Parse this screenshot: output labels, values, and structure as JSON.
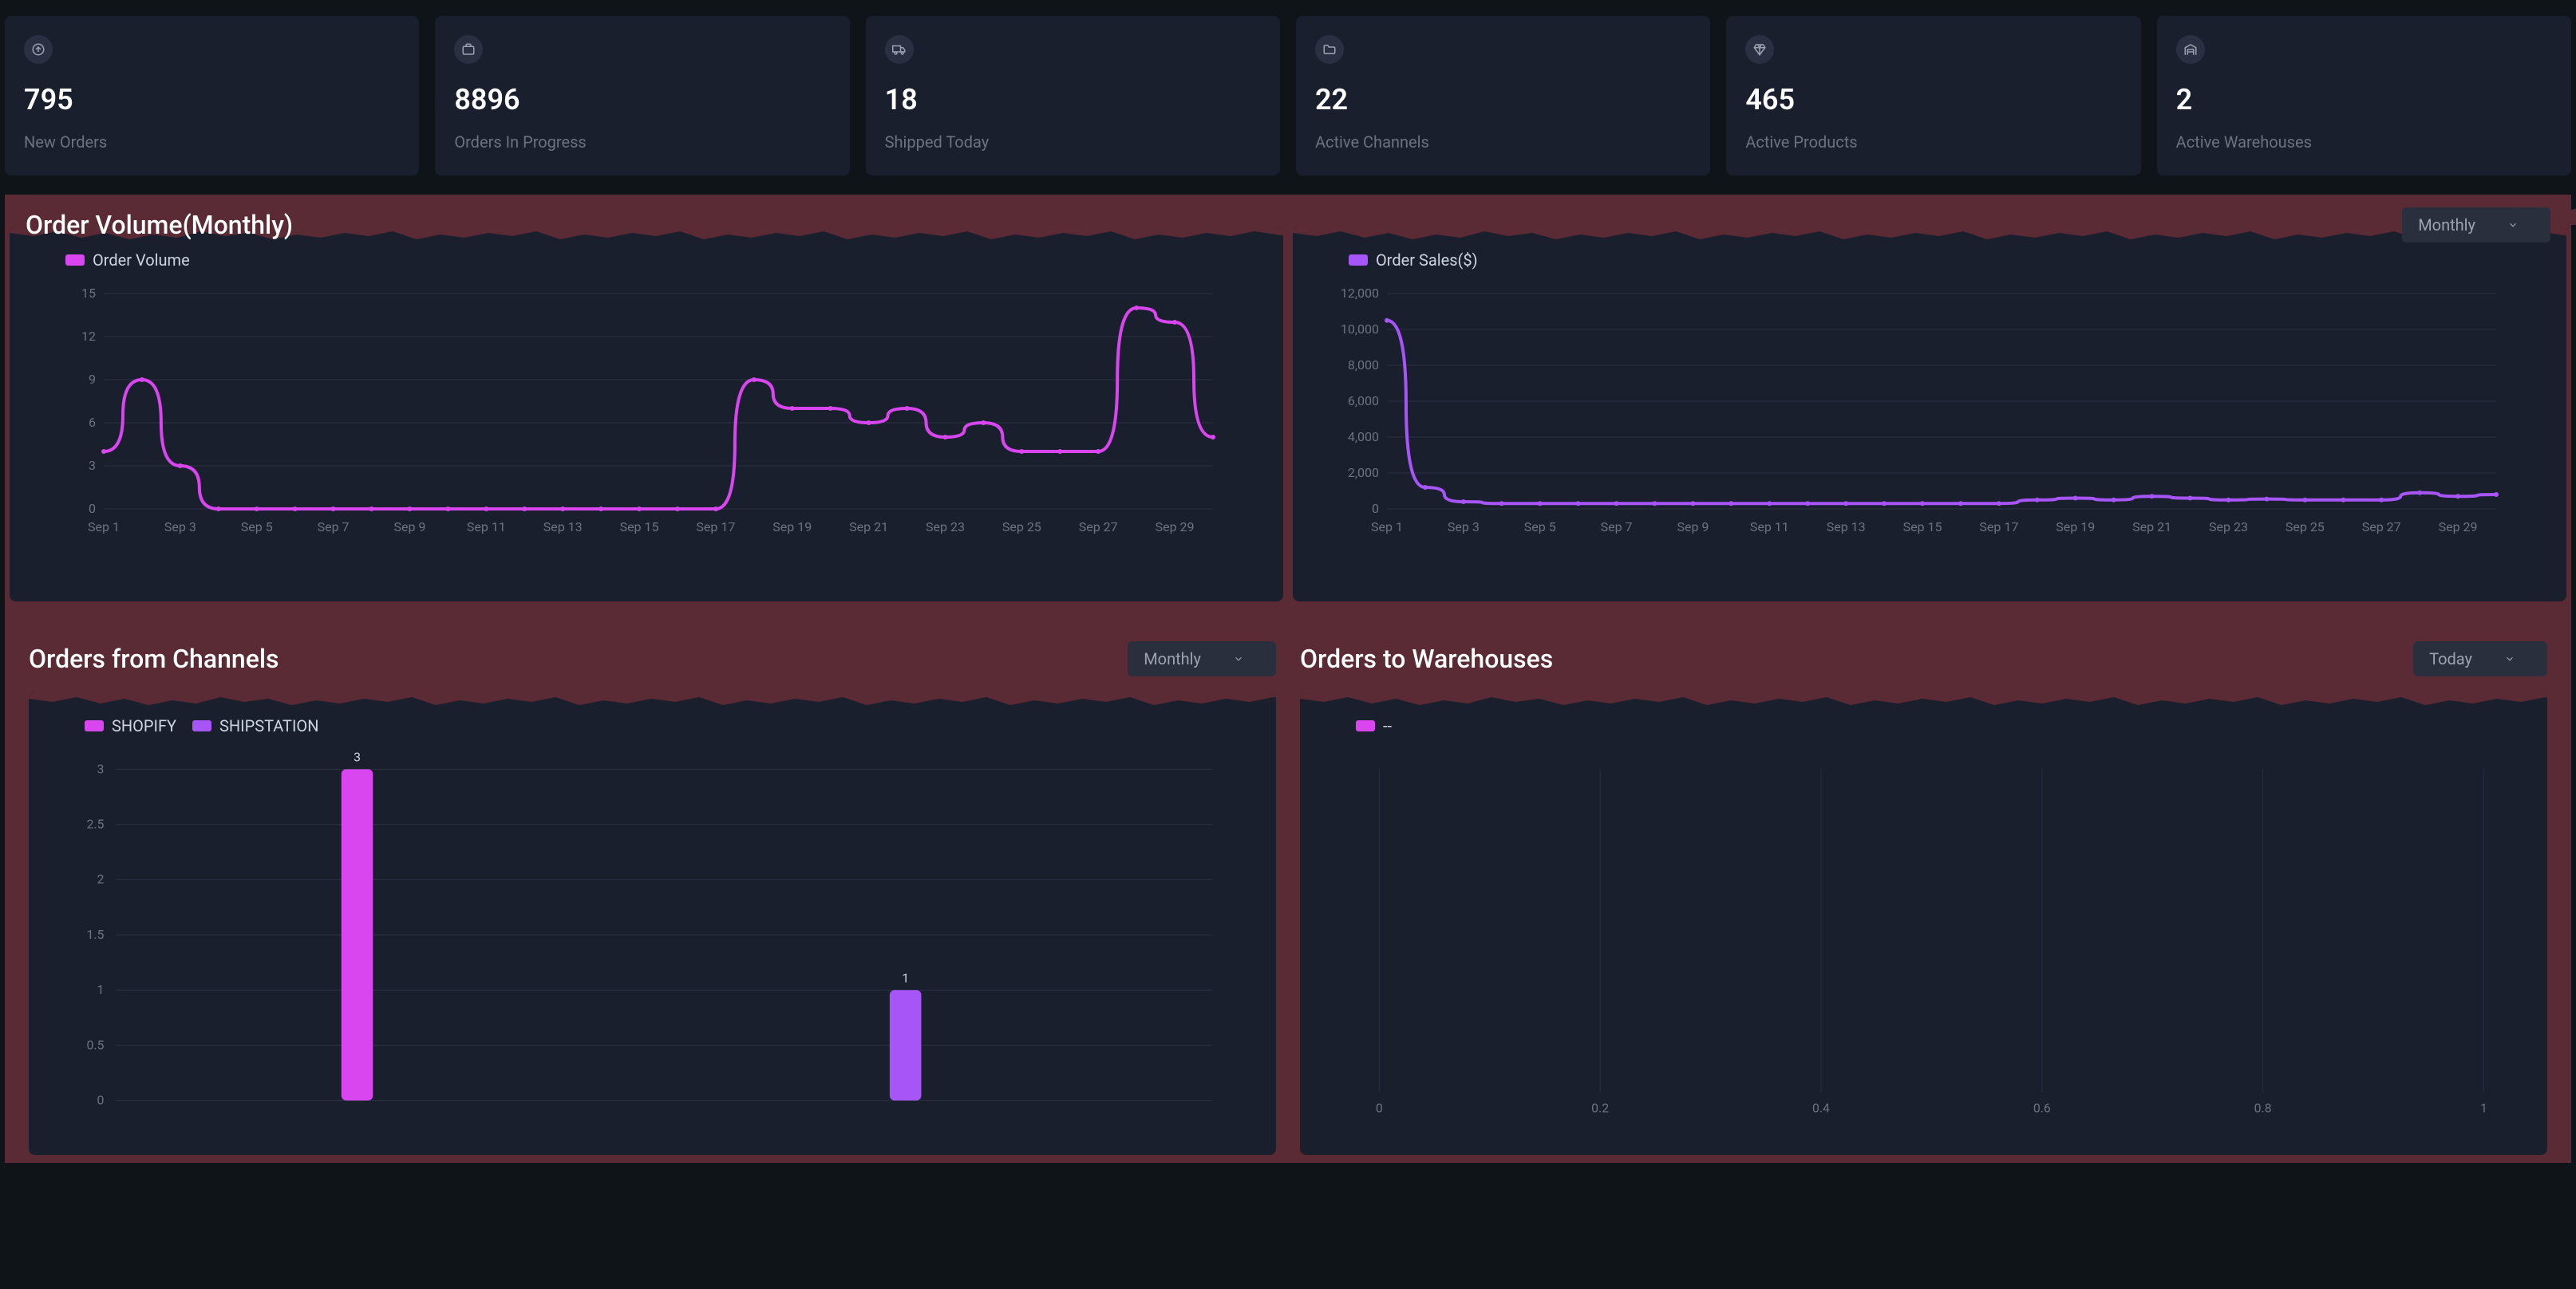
{
  "stats": [
    {
      "value": "795",
      "label": "New Orders",
      "icon": "arrow-up-circle"
    },
    {
      "value": "8896",
      "label": "Orders In Progress",
      "icon": "briefcase"
    },
    {
      "value": "18",
      "label": "Shipped Today",
      "icon": "truck"
    },
    {
      "value": "22",
      "label": "Active Channels",
      "icon": "folder"
    },
    {
      "value": "465",
      "label": "Active Products",
      "icon": "diamond"
    },
    {
      "value": "2",
      "label": "Active Warehouses",
      "icon": "warehouse"
    }
  ],
  "section1": {
    "title": "Order Volume(Monthly)",
    "dropdown": "Monthly"
  },
  "chart_volume": {
    "legend": "Order Volume",
    "color": "#d946ef"
  },
  "chart_sales": {
    "legend": "Order Sales($)",
    "color": "#a855f7"
  },
  "section2a": {
    "title": "Orders from Channels",
    "dropdown": "Monthly"
  },
  "chart_channels": {
    "legend1": "SHOPIFY",
    "legend2": "SHIPSTATION",
    "color1": "#d946ef",
    "color2": "#a855f7"
  },
  "section2b": {
    "title": "Orders to Warehouses",
    "dropdown": "Today"
  },
  "chart_warehouses": {
    "legend": "--",
    "color": "#d946ef"
  },
  "chart_data": [
    {
      "type": "line",
      "title": "Order Volume (Monthly)",
      "series": [
        {
          "name": "Order Volume",
          "color": "#d946ef",
          "values": [
            4,
            9,
            3,
            0,
            0,
            0,
            0,
            0,
            0,
            0,
            0,
            0,
            0,
            0,
            0,
            0,
            0,
            9,
            7,
            7,
            6,
            7,
            5,
            6,
            4,
            4,
            4,
            14,
            13,
            5
          ]
        }
      ],
      "categories": [
        "Sep 1",
        "Sep 2",
        "Sep 3",
        "Sep 4",
        "Sep 5",
        "Sep 6",
        "Sep 7",
        "Sep 8",
        "Sep 9",
        "Sep 10",
        "Sep 11",
        "Sep 12",
        "Sep 13",
        "Sep 14",
        "Sep 15",
        "Sep 16",
        "Sep 17",
        "Sep 18",
        "Sep 19",
        "Sep 20",
        "Sep 21",
        "Sep 22",
        "Sep 23",
        "Sep 24",
        "Sep 25",
        "Sep 26",
        "Sep 27",
        "Sep 28",
        "Sep 29",
        "Sep 30"
      ],
      "x_tick_labels": [
        "Sep 1",
        "Sep 3",
        "Sep 5",
        "Sep 7",
        "Sep 9",
        "Sep 11",
        "Sep 13",
        "Sep 15",
        "Sep 17",
        "Sep 19",
        "Sep 21",
        "Sep 23",
        "Sep 25",
        "Sep 27",
        "Sep 29"
      ],
      "ylabel": "",
      "ylim": [
        0,
        15
      ],
      "y_ticks": [
        0,
        3,
        6,
        9,
        12,
        15
      ]
    },
    {
      "type": "line",
      "title": "Order Sales ($) (Monthly)",
      "series": [
        {
          "name": "Order Sales($)",
          "color": "#a855f7",
          "values": [
            10500,
            1200,
            400,
            300,
            300,
            300,
            300,
            300,
            300,
            300,
            300,
            300,
            300,
            300,
            300,
            300,
            300,
            500,
            600,
            500,
            700,
            600,
            500,
            550,
            500,
            500,
            500,
            900,
            700,
            800
          ]
        }
      ],
      "categories": [
        "Sep 1",
        "Sep 2",
        "Sep 3",
        "Sep 4",
        "Sep 5",
        "Sep 6",
        "Sep 7",
        "Sep 8",
        "Sep 9",
        "Sep 10",
        "Sep 11",
        "Sep 12",
        "Sep 13",
        "Sep 14",
        "Sep 15",
        "Sep 16",
        "Sep 17",
        "Sep 18",
        "Sep 19",
        "Sep 20",
        "Sep 21",
        "Sep 22",
        "Sep 23",
        "Sep 24",
        "Sep 25",
        "Sep 26",
        "Sep 27",
        "Sep 28",
        "Sep 29",
        "Sep 30"
      ],
      "x_tick_labels": [
        "Sep 1",
        "Sep 3",
        "Sep 5",
        "Sep 7",
        "Sep 9",
        "Sep 11",
        "Sep 13",
        "Sep 15",
        "Sep 17",
        "Sep 19",
        "Sep 21",
        "Sep 23",
        "Sep 25",
        "Sep 27",
        "Sep 29"
      ],
      "ylabel": "",
      "ylim": [
        0,
        12000
      ],
      "y_ticks": [
        0,
        2000,
        4000,
        6000,
        8000,
        10000,
        12000
      ],
      "y_tick_labels": [
        "0",
        "2,000",
        "4,000",
        "6,000",
        "8,000",
        "10,000",
        "12,000"
      ]
    },
    {
      "type": "bar",
      "title": "Orders from Channels (Monthly)",
      "series": [
        {
          "name": "SHOPIFY",
          "color": "#d946ef",
          "values": [
            3
          ]
        },
        {
          "name": "SHIPSTATION",
          "color": "#a855f7",
          "values": [
            1
          ]
        }
      ],
      "categories": [
        ""
      ],
      "ylabel": "",
      "ylim": [
        0,
        3
      ],
      "y_ticks": [
        0,
        0.5,
        1,
        1.5,
        2,
        2.5,
        3
      ]
    },
    {
      "type": "bar",
      "title": "Orders to Warehouses (Today)",
      "series": [
        {
          "name": "--",
          "color": "#d946ef",
          "values": []
        }
      ],
      "categories": [],
      "x_ticks": [
        0,
        0.2,
        0.4,
        0.6,
        0.8,
        1
      ],
      "ylabel": "",
      "ylim": [
        0,
        0
      ]
    }
  ]
}
